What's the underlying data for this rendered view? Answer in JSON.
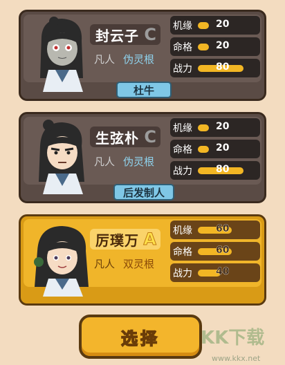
{
  "cards": [
    {
      "name": "封云子",
      "grade": "C",
      "rank": "凡人",
      "root": "伪灵根",
      "title": "杜牛",
      "stats": [
        {
          "label": "机缘",
          "value": "20",
          "fill": 0.2
        },
        {
          "label": "命格",
          "value": "20",
          "fill": 0.2
        },
        {
          "label": "战力",
          "value": "80",
          "fill": 0.8
        }
      ]
    },
    {
      "name": "生弦朴",
      "grade": "C",
      "rank": "凡人",
      "root": "伪灵根",
      "title": "后发制人",
      "stats": [
        {
          "label": "机缘",
          "value": "20",
          "fill": 0.2
        },
        {
          "label": "命格",
          "value": "20",
          "fill": 0.2
        },
        {
          "label": "战力",
          "value": "80",
          "fill": 0.8
        }
      ]
    },
    {
      "name": "厉璞万",
      "grade": "A",
      "rank": "凡人",
      "root": "双灵根",
      "title": "",
      "stats": [
        {
          "label": "机缘",
          "value": "60",
          "fill": 0.6
        },
        {
          "label": "命格",
          "value": "60",
          "fill": 0.6
        },
        {
          "label": "战力",
          "value": "40",
          "fill": 0.4
        }
      ]
    }
  ],
  "select_label": "选择",
  "watermark": "KK下载",
  "watermark_url": "www.kkx.net",
  "colors": {
    "accent": "#f2b624",
    "selected_card": "#d99b16",
    "card": "#5a4b45"
  }
}
